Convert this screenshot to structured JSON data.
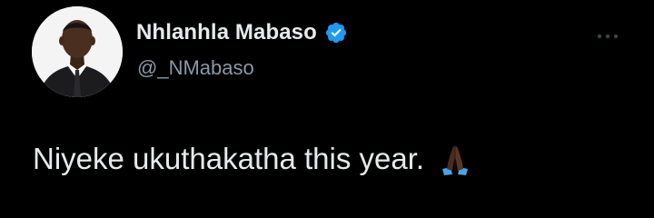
{
  "author": {
    "display_name": "Nhlanhla Mabaso",
    "handle": "@_NMabaso",
    "verified": true,
    "avatar_icon": "profile-photo"
  },
  "tweet": {
    "text": "Niyeke ukuthakatha this year.",
    "emoji_icon": "folded-hands-icon"
  },
  "menu": {
    "icon": "more-options-icon"
  },
  "colors": {
    "background": "#000000",
    "primary_text": "#e7e9ea",
    "secondary_text": "#8b98a5",
    "verified_badge": "#1d9bf0"
  }
}
